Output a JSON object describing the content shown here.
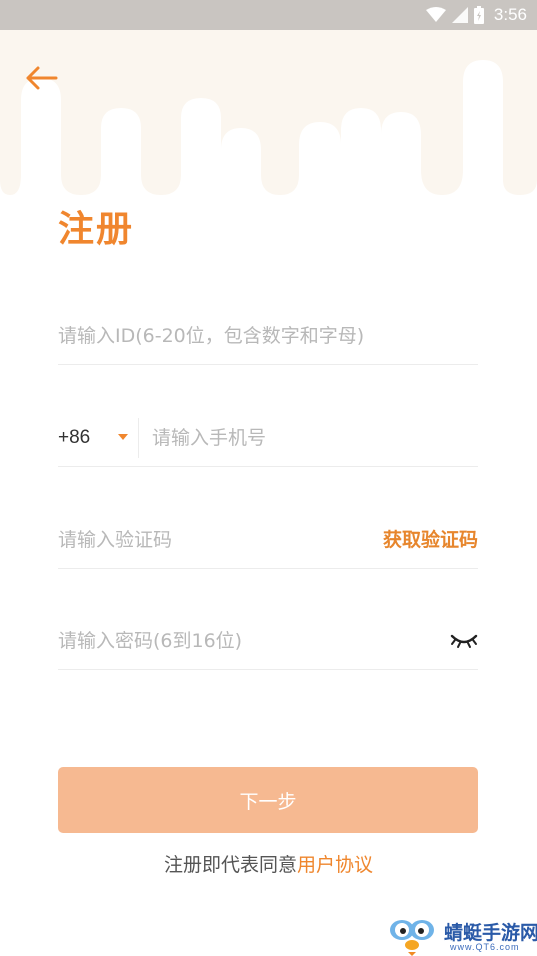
{
  "status_bar": {
    "time": "3:56"
  },
  "header": {
    "title": "注册"
  },
  "form": {
    "id_placeholder": "请输入ID(6-20位，包含数字和字母)",
    "country_code": "+86",
    "phone_placeholder": "请输入手机号",
    "code_placeholder": "请输入验证码",
    "get_code_label": "获取验证码",
    "password_placeholder": "请输入密码(6到16位)"
  },
  "actions": {
    "next_label": "下一步"
  },
  "agreement": {
    "prefix": "注册即代表同意",
    "link": "用户协议"
  },
  "watermark": {
    "name": "蜻蜓手游网",
    "url": "www.QT6.com"
  },
  "colors": {
    "accent": "#f0862e",
    "button": "#f6b991",
    "header_bg": "#fbf6ef",
    "status_bar": "#c9c5c1"
  }
}
